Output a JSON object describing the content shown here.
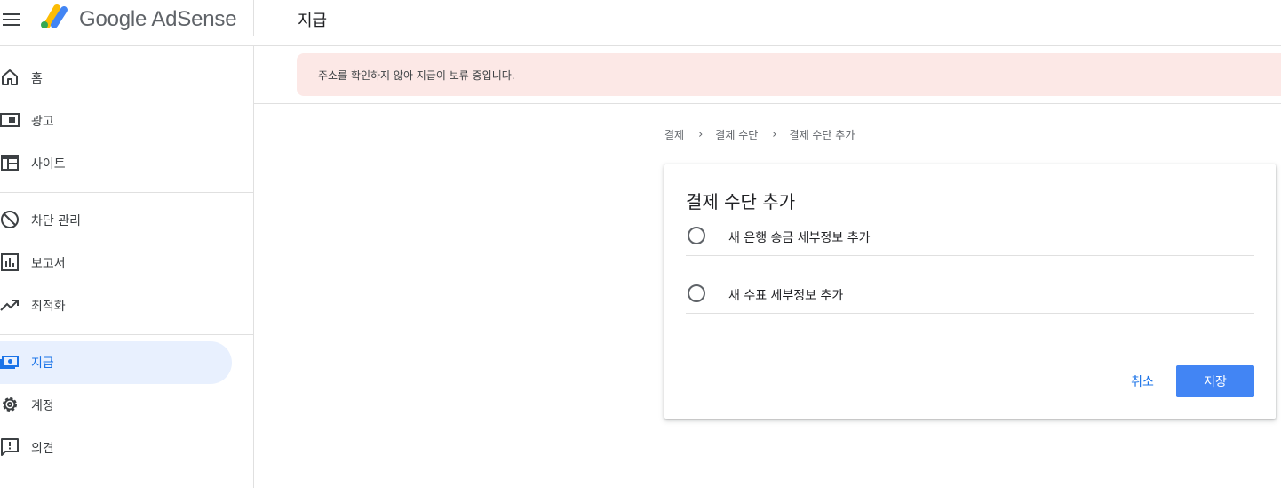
{
  "app": {
    "brand": "Google AdSense",
    "page_title": "지급"
  },
  "sidebar": {
    "items": [
      {
        "label": "홈",
        "icon": "home-icon"
      },
      {
        "label": "광고",
        "icon": "ads-icon"
      },
      {
        "label": "사이트",
        "icon": "sites-icon"
      },
      {
        "label": "차단 관리",
        "icon": "block-icon"
      },
      {
        "label": "보고서",
        "icon": "reports-icon"
      },
      {
        "label": "최적화",
        "icon": "trending-icon"
      },
      {
        "label": "지급",
        "icon": "payments-icon",
        "active": true
      },
      {
        "label": "계정",
        "icon": "gear-icon"
      },
      {
        "label": "의견",
        "icon": "feedback-icon"
      }
    ]
  },
  "alert": {
    "text": "주소를 확인하지 않아 지급이 보류 중입니다."
  },
  "breadcrumb": {
    "items": [
      "결제",
      "결제 수단",
      "결제 수단 추가"
    ]
  },
  "card": {
    "title": "결제 수단 추가",
    "options": [
      {
        "label": "새 은행 송금 세부정보 추가",
        "selected": false
      },
      {
        "label": "새 수표 세부정보 추가",
        "selected": false
      }
    ],
    "cancel_label": "취소",
    "save_label": "저장"
  },
  "colors": {
    "accent": "#1a73e8",
    "save_button": "#4285f4",
    "alert_bg": "#fce8e6",
    "active_nav_bg": "#e8f0fe"
  }
}
